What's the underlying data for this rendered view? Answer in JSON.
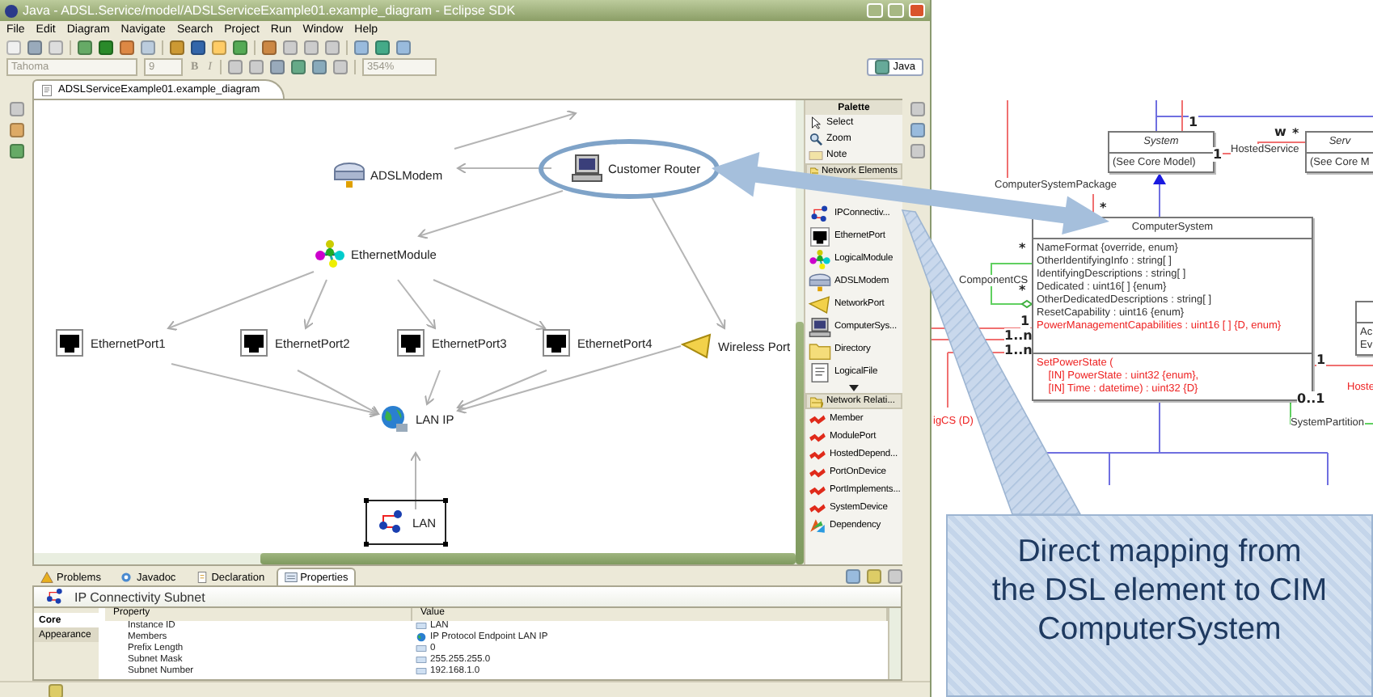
{
  "window": {
    "title": "Java - ADSL.Service/model/ADSLServiceExample01.example_diagram - Eclipse SDK"
  },
  "menu": [
    "File",
    "Edit",
    "Diagram",
    "Navigate",
    "Search",
    "Project",
    "Run",
    "Window",
    "Help"
  ],
  "format_toolbar": {
    "font": "Tahoma",
    "size": "9",
    "bold": "B",
    "italic": "I",
    "zoom": "354%"
  },
  "perspective": {
    "label": "Java",
    "selected": true
  },
  "editor_tab": {
    "label": "ADSLServiceExample01.example_diagram",
    "selected": true
  },
  "diagram": {
    "nodes": [
      {
        "kind": "modem",
        "label": "ADSLModem",
        "selected": false,
        "highlighted": false
      },
      {
        "kind": "computer",
        "label": "Customer Router",
        "selected": false,
        "highlighted": true
      },
      {
        "kind": "module",
        "label": "EthernetModule",
        "selected": false,
        "highlighted": false
      },
      {
        "kind": "port",
        "label": "EthernetPort1",
        "selected": false,
        "highlighted": false
      },
      {
        "kind": "port",
        "label": "EthernetPort2",
        "selected": false,
        "highlighted": false
      },
      {
        "kind": "port",
        "label": "EthernetPort3",
        "selected": false,
        "highlighted": false
      },
      {
        "kind": "port",
        "label": "EthernetPort4",
        "selected": false,
        "highlighted": false
      },
      {
        "kind": "wireless",
        "label": "Wireless Port",
        "selected": false,
        "highlighted": false
      },
      {
        "kind": "ip",
        "label": "LAN IP",
        "selected": false,
        "highlighted": false
      },
      {
        "kind": "subnet",
        "label": "LAN",
        "selected": true,
        "highlighted": false
      }
    ]
  },
  "palette": {
    "title": "Palette",
    "tools": [
      {
        "kind": "select",
        "label": "Select"
      },
      {
        "kind": "zoom",
        "label": "Zoom"
      },
      {
        "kind": "note",
        "label": "Note"
      }
    ],
    "drawers": [
      {
        "label": "Network Elements",
        "expanded": true,
        "items": [
          {
            "kind": "subnet",
            "label": "IPConnectiv..."
          },
          {
            "kind": "port",
            "label": "EthernetPort"
          },
          {
            "kind": "module",
            "label": "LogicalModule"
          },
          {
            "kind": "modem",
            "label": "ADSLModem"
          },
          {
            "kind": "wireless",
            "label": "NetworkPort"
          },
          {
            "kind": "computer",
            "label": "ComputerSys..."
          },
          {
            "kind": "folder",
            "label": "Directory"
          },
          {
            "kind": "file",
            "label": "LogicalFile"
          }
        ]
      },
      {
        "label": "Network Relati...",
        "expanded": true,
        "items": [
          {
            "kind": "relation",
            "label": "Member"
          },
          {
            "kind": "relation",
            "label": "ModulePort"
          },
          {
            "kind": "relation",
            "label": "HostedDepend..."
          },
          {
            "kind": "relation",
            "label": "PortOnDevice"
          },
          {
            "kind": "relation",
            "label": "PortImplements..."
          },
          {
            "kind": "relation",
            "label": "SystemDevice"
          },
          {
            "kind": "dependency",
            "label": "Dependency"
          }
        ]
      }
    ]
  },
  "views": {
    "tabs": [
      {
        "kind": "problems",
        "label": "Problems",
        "selected": false
      },
      {
        "kind": "javadoc",
        "label": "Javadoc",
        "selected": false
      },
      {
        "kind": "declaration",
        "label": "Declaration",
        "selected": false
      },
      {
        "kind": "properties",
        "label": "Properties",
        "selected": true
      }
    ],
    "header": "IP Connectivity Subnet",
    "side_tabs": [
      {
        "label": "Core",
        "selected": true
      },
      {
        "label": "Appearance",
        "selected": false
      }
    ],
    "columns": [
      "Property",
      "Value"
    ],
    "rows": [
      {
        "kind": "text",
        "property": "Instance ID",
        "value": "LAN"
      },
      {
        "kind": "reference",
        "property": "Members",
        "value": "IP Protocol Endpoint LAN IP"
      },
      {
        "kind": "text",
        "property": "Prefix Length",
        "value": "0"
      },
      {
        "kind": "text",
        "property": "Subnet Mask",
        "value": "255.255.255.0"
      },
      {
        "kind": "text",
        "property": "Subnet Number",
        "value": "192.168.1.0"
      }
    ]
  },
  "uml": {
    "classes": [
      {
        "name": "System",
        "abstract": true,
        "attributes": [
          {
            "text": "(See Core Model)",
            "color": "#333333"
          }
        ]
      },
      {
        "name": "Serv",
        "abstract": true,
        "attributes": [
          {
            "text": "(See Core M",
            "color": "#333333"
          }
        ]
      },
      {
        "name": "ComputerSystem",
        "abstract": false,
        "attributes": [
          {
            "text": "NameFormat {override, enum}",
            "color": "#333333"
          },
          {
            "text": "OtherIdentifyingInfo : string[ ]",
            "color": "#333333"
          },
          {
            "text": "IdentifyingDescriptions : string[ ]",
            "color": "#333333"
          },
          {
            "text": "Dedicated : uint16[ ] {enum}",
            "color": "#333333"
          },
          {
            "text": "OtherDedicatedDescriptions : string[ ]",
            "color": "#333333"
          },
          {
            "text": "ResetCapability : uint16 {enum}",
            "color": "#333333"
          },
          {
            "text": "PowerManagementCapabilities : uint16 [ ] {D, enum}",
            "color": "#ee2222"
          }
        ],
        "methods": [
          {
            "text": "SetPowerState (",
            "color": "#ee2222"
          },
          {
            "text": "    [IN] PowerState : uint32 {enum},",
            "color": "#ee2222"
          },
          {
            "text": "    [IN] Time : datetime) : uint32 {D}",
            "color": "#ee2222"
          }
        ]
      },
      {
        "attributes": [
          {
            "text": "Ac",
            "color": "#333333"
          },
          {
            "text": "Ev",
            "color": "#333333"
          }
        ]
      }
    ],
    "labels": [
      {
        "text": "ComputerSystemPackage",
        "color": "#333333"
      },
      {
        "text": "HostedService",
        "color": "#333333"
      },
      {
        "text": "ComponentCS",
        "color": "#333333"
      },
      {
        "text": "SystemPartition",
        "color": "#333333"
      },
      {
        "text": "Hoste",
        "color": "#ee2222"
      },
      {
        "text": "igCS (D)",
        "color": "#ee2222"
      },
      {
        "text": "1",
        "color": "#222222"
      },
      {
        "text": "1",
        "color": "#222222"
      },
      {
        "text": "w",
        "color": "#222222"
      },
      {
        "text": "*",
        "color": "#222222"
      },
      {
        "text": "*",
        "color": "#222222"
      },
      {
        "text": "*",
        "color": "#222222"
      },
      {
        "text": "*",
        "color": "#222222"
      },
      {
        "text": "1",
        "color": "#222222"
      },
      {
        "text": "1..n",
        "color": "#222222"
      },
      {
        "text": "1..n",
        "color": "#222222"
      },
      {
        "text": "1",
        "color": "#222222"
      },
      {
        "text": "0..1",
        "color": "#222222"
      }
    ]
  },
  "callout": {
    "lines": [
      "Direct mapping from",
      "the DSL element to CIM",
      "ComputerSystem"
    ]
  }
}
